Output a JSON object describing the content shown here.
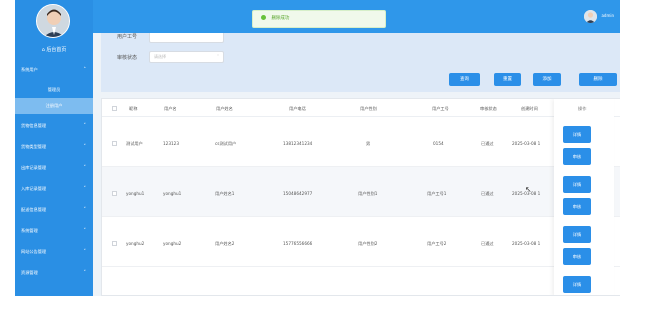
{
  "sidebar": {
    "home_label": "后台首页",
    "items": [
      {
        "label": "系统用户",
        "expanded": true,
        "children": [
          {
            "label": "管理员"
          },
          {
            "label": "注册用户",
            "active": true
          }
        ]
      },
      {
        "label": "货物信息管理"
      },
      {
        "label": "货物类型管理"
      },
      {
        "label": "出库记录管理"
      },
      {
        "label": "入库记录管理"
      },
      {
        "label": "配送信息管理"
      },
      {
        "label": "系统管理"
      },
      {
        "label": "网站公告管理"
      },
      {
        "label": "资源管理"
      }
    ]
  },
  "topbar": {
    "toast_text": "删除成功",
    "user_name": "admin"
  },
  "filter": {
    "user_no_label": "用户工号",
    "status_label": "审核状态",
    "status_placeholder": "请选择",
    "buttons": {
      "query": "查询",
      "reset": "重置",
      "add": "添加",
      "delete": "删除"
    }
  },
  "table": {
    "columns": [
      "昵称",
      "用户名",
      "用户姓名",
      "用户电话",
      "用户性别",
      "用户工号",
      "审核状态",
      "创建时间",
      "操作"
    ],
    "rows": [
      {
        "nickname": "测试用户",
        "username": "123123",
        "name": "cs测试用户",
        "phone": "13812341234",
        "gender": "男",
        "work_no": "0154",
        "status": "已通过",
        "created": "2025-03-08 1"
      },
      {
        "nickname": "yonghu1",
        "username": "yonghu1",
        "name": "用户姓名1",
        "phone": "15048642977",
        "gender": "用户性别1",
        "work_no": "用户工号1",
        "status": "已通过",
        "created": "2025-03-08 1"
      },
      {
        "nickname": "yonghu2",
        "username": "yonghu2",
        "name": "用户姓名2",
        "phone": "15776556666",
        "gender": "用户性别2",
        "work_no": "用户工号2",
        "status": "已通过",
        "created": "2025-03-08 1"
      }
    ],
    "actions": {
      "detail": "详情",
      "edit": "审核"
    }
  },
  "colors": {
    "sidebar": "#2a8fe4",
    "topbar": "#2f97ea",
    "accent": "#2b8fe8",
    "success": "#67c23a"
  }
}
